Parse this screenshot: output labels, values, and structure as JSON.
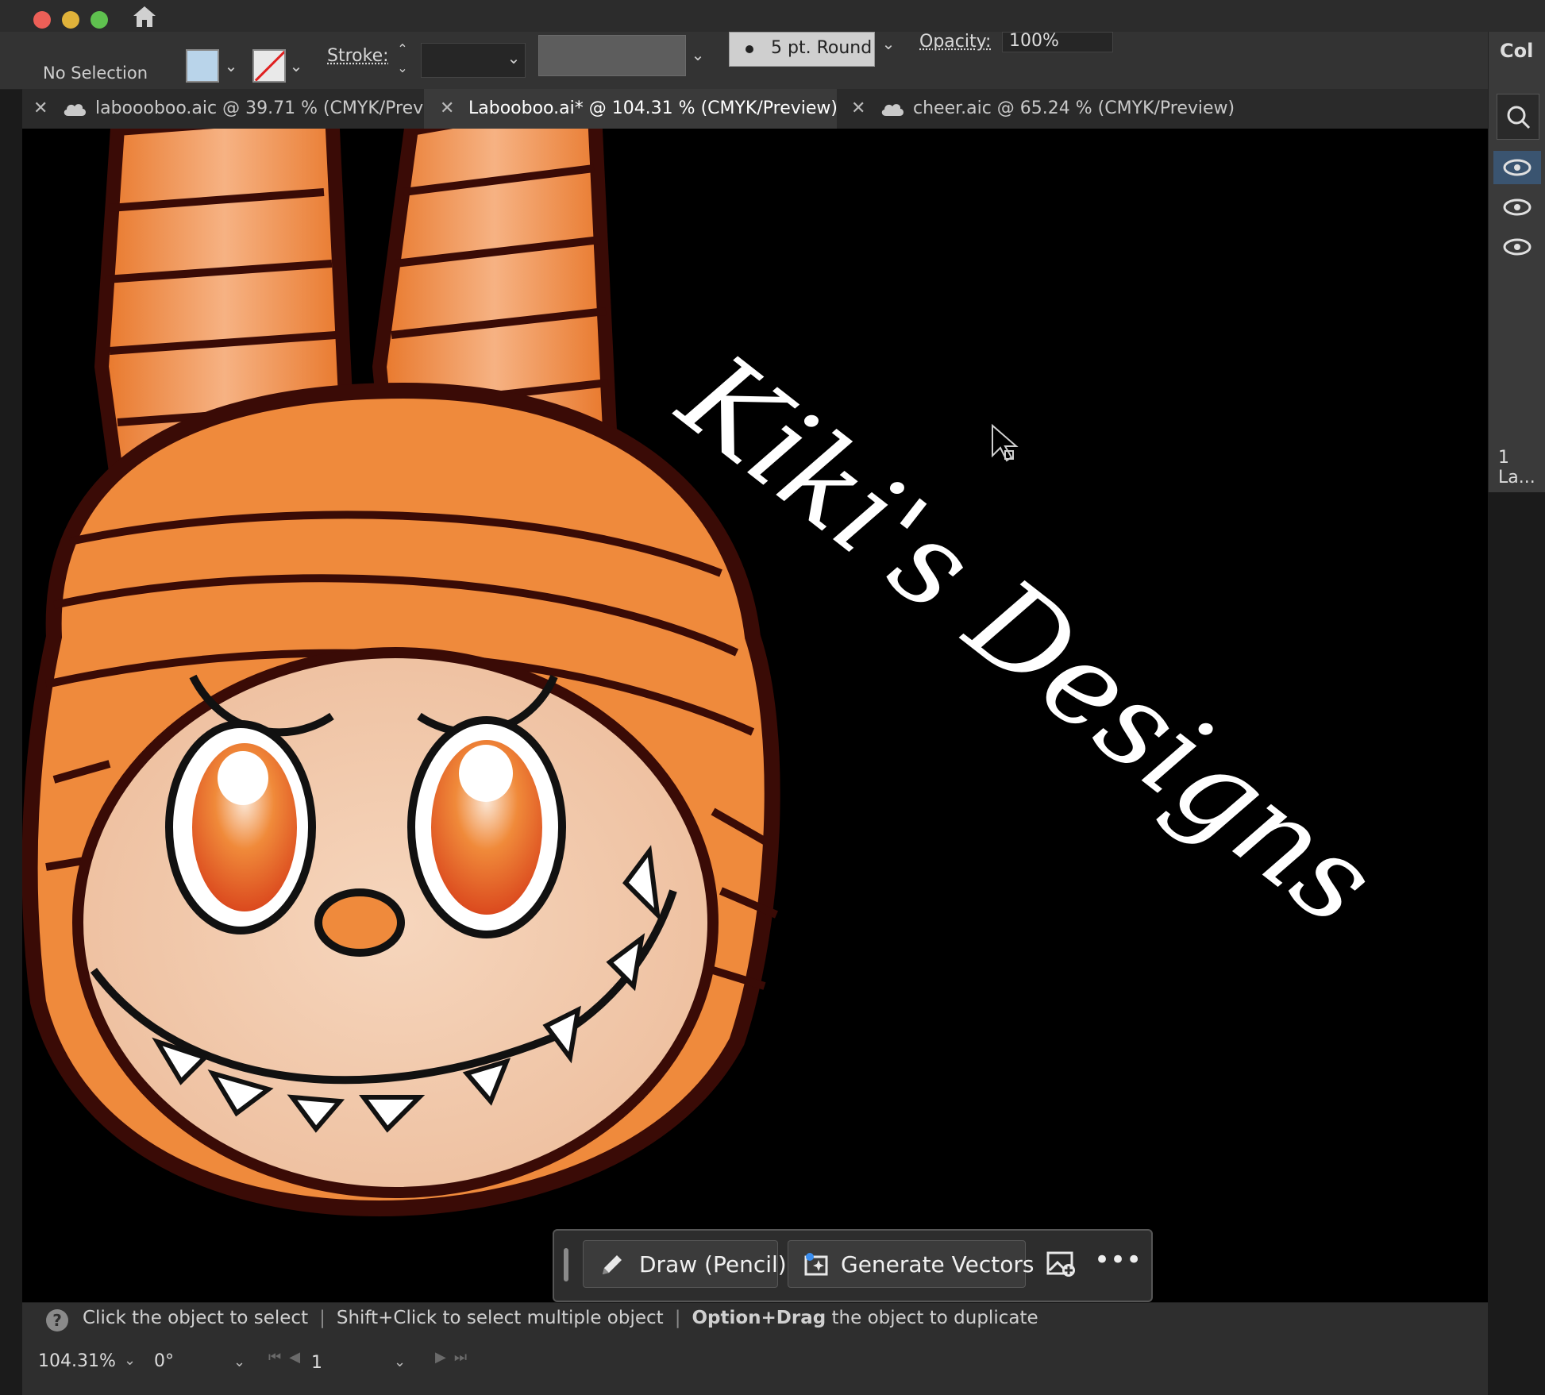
{
  "window": {
    "traffic_lights": [
      "close",
      "minimize",
      "zoom"
    ]
  },
  "control_bar": {
    "selection_status": "No Selection",
    "stroke_label": "Stroke:",
    "brush_definition": "5 pt. Round",
    "opacity_label": "Opacity:",
    "opacity_value": "100%",
    "fill_color": "#b9d4ea"
  },
  "tabs": [
    {
      "label": "laboooboo.aic @ 39.71 % (CMYK/Preview)",
      "cloud": true,
      "active": false
    },
    {
      "label": "Labooboo.ai* @ 104.31 % (CMYK/Preview)",
      "cloud": false,
      "active": true
    },
    {
      "label": "cheer.aic @ 65.24 % (CMYK/Preview)",
      "cloud": true,
      "active": false
    }
  ],
  "right_panel": {
    "title": "Col",
    "layers_count": "1 La..."
  },
  "canvas": {
    "artwork_text": "Kiki's Designs",
    "artwork_colors": {
      "orange": "#f08a3a",
      "outline": "#3a0b06",
      "skin": "#f2c8a8",
      "background": "#000000"
    }
  },
  "context_toolbar": {
    "draw_button": "Draw (Pencil)",
    "generate_button": "Generate Vectors",
    "more_label": "•••"
  },
  "status_bar": {
    "hint": "Click the object to select",
    "hint2": "Shift+Click to select multiple object",
    "hint3_bold": "Option+Drag",
    "hint3_rest": "the object to duplicate",
    "zoom": "104.31%",
    "rotation": "0°",
    "artboard": "1"
  }
}
